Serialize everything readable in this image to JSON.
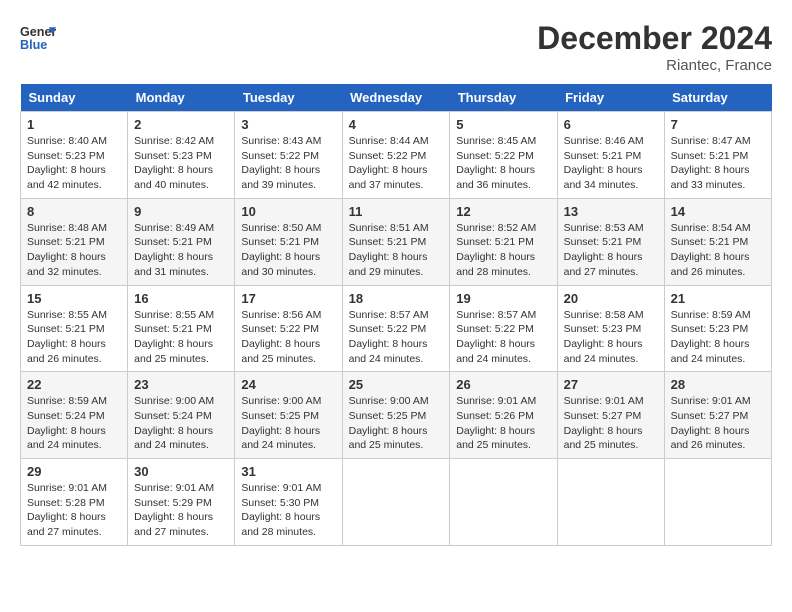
{
  "header": {
    "logo_line1": "General",
    "logo_line2": "Blue",
    "month_year": "December 2024",
    "location": "Riantec, France"
  },
  "weekdays": [
    "Sunday",
    "Monday",
    "Tuesday",
    "Wednesday",
    "Thursday",
    "Friday",
    "Saturday"
  ],
  "weeks": [
    [
      {
        "day": "1",
        "sunrise": "8:40 AM",
        "sunset": "5:23 PM",
        "daylight": "8 hours and 42 minutes."
      },
      {
        "day": "2",
        "sunrise": "8:42 AM",
        "sunset": "5:23 PM",
        "daylight": "8 hours and 40 minutes."
      },
      {
        "day": "3",
        "sunrise": "8:43 AM",
        "sunset": "5:22 PM",
        "daylight": "8 hours and 39 minutes."
      },
      {
        "day": "4",
        "sunrise": "8:44 AM",
        "sunset": "5:22 PM",
        "daylight": "8 hours and 37 minutes."
      },
      {
        "day": "5",
        "sunrise": "8:45 AM",
        "sunset": "5:22 PM",
        "daylight": "8 hours and 36 minutes."
      },
      {
        "day": "6",
        "sunrise": "8:46 AM",
        "sunset": "5:21 PM",
        "daylight": "8 hours and 34 minutes."
      },
      {
        "day": "7",
        "sunrise": "8:47 AM",
        "sunset": "5:21 PM",
        "daylight": "8 hours and 33 minutes."
      }
    ],
    [
      {
        "day": "8",
        "sunrise": "8:48 AM",
        "sunset": "5:21 PM",
        "daylight": "8 hours and 32 minutes."
      },
      {
        "day": "9",
        "sunrise": "8:49 AM",
        "sunset": "5:21 PM",
        "daylight": "8 hours and 31 minutes."
      },
      {
        "day": "10",
        "sunrise": "8:50 AM",
        "sunset": "5:21 PM",
        "daylight": "8 hours and 30 minutes."
      },
      {
        "day": "11",
        "sunrise": "8:51 AM",
        "sunset": "5:21 PM",
        "daylight": "8 hours and 29 minutes."
      },
      {
        "day": "12",
        "sunrise": "8:52 AM",
        "sunset": "5:21 PM",
        "daylight": "8 hours and 28 minutes."
      },
      {
        "day": "13",
        "sunrise": "8:53 AM",
        "sunset": "5:21 PM",
        "daylight": "8 hours and 27 minutes."
      },
      {
        "day": "14",
        "sunrise": "8:54 AM",
        "sunset": "5:21 PM",
        "daylight": "8 hours and 26 minutes."
      }
    ],
    [
      {
        "day": "15",
        "sunrise": "8:55 AM",
        "sunset": "5:21 PM",
        "daylight": "8 hours and 26 minutes."
      },
      {
        "day": "16",
        "sunrise": "8:55 AM",
        "sunset": "5:21 PM",
        "daylight": "8 hours and 25 minutes."
      },
      {
        "day": "17",
        "sunrise": "8:56 AM",
        "sunset": "5:22 PM",
        "daylight": "8 hours and 25 minutes."
      },
      {
        "day": "18",
        "sunrise": "8:57 AM",
        "sunset": "5:22 PM",
        "daylight": "8 hours and 24 minutes."
      },
      {
        "day": "19",
        "sunrise": "8:57 AM",
        "sunset": "5:22 PM",
        "daylight": "8 hours and 24 minutes."
      },
      {
        "day": "20",
        "sunrise": "8:58 AM",
        "sunset": "5:23 PM",
        "daylight": "8 hours and 24 minutes."
      },
      {
        "day": "21",
        "sunrise": "8:59 AM",
        "sunset": "5:23 PM",
        "daylight": "8 hours and 24 minutes."
      }
    ],
    [
      {
        "day": "22",
        "sunrise": "8:59 AM",
        "sunset": "5:24 PM",
        "daylight": "8 hours and 24 minutes."
      },
      {
        "day": "23",
        "sunrise": "9:00 AM",
        "sunset": "5:24 PM",
        "daylight": "8 hours and 24 minutes."
      },
      {
        "day": "24",
        "sunrise": "9:00 AM",
        "sunset": "5:25 PM",
        "daylight": "8 hours and 24 minutes."
      },
      {
        "day": "25",
        "sunrise": "9:00 AM",
        "sunset": "5:25 PM",
        "daylight": "8 hours and 25 minutes."
      },
      {
        "day": "26",
        "sunrise": "9:01 AM",
        "sunset": "5:26 PM",
        "daylight": "8 hours and 25 minutes."
      },
      {
        "day": "27",
        "sunrise": "9:01 AM",
        "sunset": "5:27 PM",
        "daylight": "8 hours and 25 minutes."
      },
      {
        "day": "28",
        "sunrise": "9:01 AM",
        "sunset": "5:27 PM",
        "daylight": "8 hours and 26 minutes."
      }
    ],
    [
      {
        "day": "29",
        "sunrise": "9:01 AM",
        "sunset": "5:28 PM",
        "daylight": "8 hours and 27 minutes."
      },
      {
        "day": "30",
        "sunrise": "9:01 AM",
        "sunset": "5:29 PM",
        "daylight": "8 hours and 27 minutes."
      },
      {
        "day": "31",
        "sunrise": "9:01 AM",
        "sunset": "5:30 PM",
        "daylight": "8 hours and 28 minutes."
      },
      null,
      null,
      null,
      null
    ]
  ],
  "labels": {
    "sunrise": "Sunrise:",
    "sunset": "Sunset:",
    "daylight": "Daylight:"
  }
}
